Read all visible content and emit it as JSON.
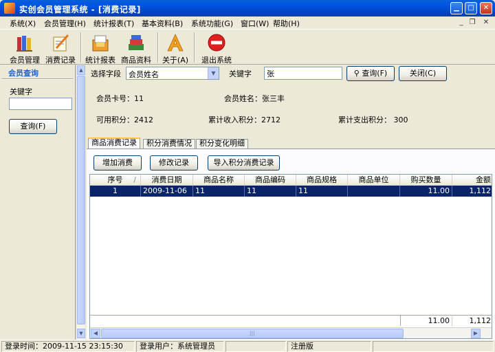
{
  "window": {
    "title": "实创会员管理系统 - [消费记录]",
    "accent": "#0055e5"
  },
  "menu": [
    "系统(X)",
    "会员管理(H)",
    "统计报表(T)",
    "基本资料(B)",
    "系统功能(G)",
    "窗口(W)",
    "帮助(H)"
  ],
  "toolbar": {
    "members": "会员管理",
    "consume": "消费记录",
    "reports": "统计报表",
    "products": "商品资料",
    "about": "关于(A)",
    "exit": "退出系统"
  },
  "left_panel": {
    "header": "会员查询",
    "keyword_label": "关键字",
    "keyword_value": "",
    "query_button": "查询(F)"
  },
  "search": {
    "field_label": "选择字段",
    "field_value": "会员姓名",
    "keyword_label": "关键字",
    "keyword_value": "张",
    "query_button": "查询(F)",
    "close_button": "关闭(C)"
  },
  "member_info": {
    "card_no": "会员卡号：11",
    "name": "会员姓名：张三丰",
    "available_points": "可用积分：2412",
    "total_income_points": "累计收入积分：2712",
    "total_spent_points": "累计支出积分：  300"
  },
  "tabs": [
    "商品消费记录",
    "积分消费情况",
    "积分变化明细"
  ],
  "actions": {
    "add": "增加消费",
    "edit": "修改记录",
    "import": "导入积分消费记录"
  },
  "grid": {
    "columns": [
      "序号",
      "消费日期",
      "商品名称",
      "商品编码",
      "商品规格",
      "商品单位",
      "购买数量",
      "金额"
    ],
    "sort_indicator": "/",
    "rows": [
      {
        "no": "1",
        "date": "2009-11-06",
        "name": "11",
        "code": "11",
        "spec": "11",
        "unit": "",
        "qty": "11.00",
        "amount": "1,112"
      }
    ],
    "footer": {
      "qty": "11.00",
      "amount": "1,112"
    }
  },
  "status": {
    "login_time": "登录时间：2009-11-15  23:15:30",
    "login_user": "登录用户：系统管理员",
    "registered": "注册版"
  }
}
